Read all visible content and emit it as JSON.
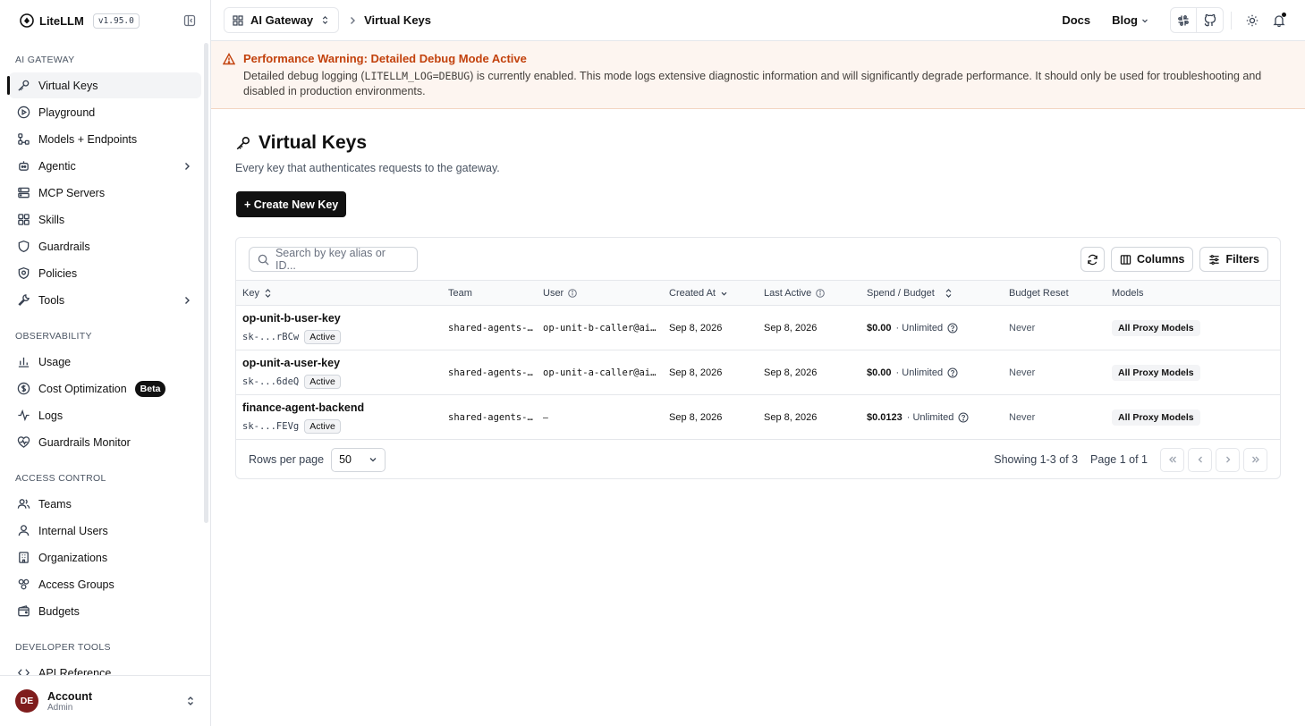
{
  "app": {
    "name": "LiteLLM",
    "version": "v1.95.0"
  },
  "sidebar": {
    "sections": [
      {
        "label": "AI GATEWAY",
        "items": [
          {
            "label": "Virtual Keys",
            "icon": "key-icon",
            "active": true
          },
          {
            "label": "Playground",
            "icon": "play-icon"
          },
          {
            "label": "Models + Endpoints",
            "icon": "models-icon"
          },
          {
            "label": "Agentic",
            "icon": "agentic-icon",
            "expandable": true
          },
          {
            "label": "MCP Servers",
            "icon": "server-icon"
          },
          {
            "label": "Skills",
            "icon": "skills-icon"
          },
          {
            "label": "Guardrails",
            "icon": "shield-icon"
          },
          {
            "label": "Policies",
            "icon": "policy-icon"
          },
          {
            "label": "Tools",
            "icon": "wrench-icon",
            "expandable": true
          }
        ]
      },
      {
        "label": "OBSERVABILITY",
        "items": [
          {
            "label": "Usage",
            "icon": "bar-chart-icon"
          },
          {
            "label": "Cost Optimization",
            "icon": "dollar-icon",
            "badge": "Beta"
          },
          {
            "label": "Logs",
            "icon": "activity-icon"
          },
          {
            "label": "Guardrails Monitor",
            "icon": "heart-monitor-icon"
          }
        ]
      },
      {
        "label": "ACCESS CONTROL",
        "items": [
          {
            "label": "Teams",
            "icon": "users-icon"
          },
          {
            "label": "Internal Users",
            "icon": "user-icon"
          },
          {
            "label": "Organizations",
            "icon": "building-icon"
          },
          {
            "label": "Access Groups",
            "icon": "groups-icon"
          },
          {
            "label": "Budgets",
            "icon": "wallet-icon"
          }
        ]
      },
      {
        "label": "DEVELOPER TOOLS",
        "items": [
          {
            "label": "API Reference",
            "icon": "code-icon"
          }
        ]
      }
    ],
    "account": {
      "initials": "DE",
      "name": "Account",
      "role": "Admin"
    }
  },
  "topbar": {
    "gateway_label": "AI Gateway",
    "breadcrumb_current": "Virtual Keys",
    "docs_label": "Docs",
    "blog_label": "Blog"
  },
  "warning": {
    "title": "Performance Warning: Detailed Debug Mode Active",
    "body_prefix": "Detailed debug logging (",
    "body_code": "LITELLM_LOG=DEBUG",
    "body_suffix": ") is currently enabled. This mode logs extensive diagnostic information and will significantly degrade performance. It should only be used for troubleshooting and disabled in production environments."
  },
  "page": {
    "title": "Virtual Keys",
    "subtitle": "Every key that authenticates requests to the gateway.",
    "create_label": "+ Create New Key"
  },
  "table": {
    "search_placeholder": "Search by key alias or ID...",
    "columns_label": "Columns",
    "filters_label": "Filters",
    "headers": {
      "key": "Key",
      "team": "Team",
      "user": "User",
      "created": "Created At",
      "last_active": "Last Active",
      "spend": "Spend / Budget",
      "reset": "Budget Reset",
      "models": "Models"
    },
    "rows": [
      {
        "alias": "op-unit-b-user-key",
        "key_id": "sk-...rBCw",
        "status": "Active",
        "team": "shared-agents-…",
        "user": "op-unit-b-caller@ai…",
        "created": "Sep 8, 2026",
        "last_active": "Sep 8, 2026",
        "spend": "$0.00",
        "budget": "· Unlimited",
        "reset": "Never",
        "models": "All Proxy Models"
      },
      {
        "alias": "op-unit-a-user-key",
        "key_id": "sk-...6deQ",
        "status": "Active",
        "team": "shared-agents-…",
        "user": "op-unit-a-caller@ai…",
        "created": "Sep 8, 2026",
        "last_active": "Sep 8, 2026",
        "spend": "$0.00",
        "budget": "· Unlimited",
        "reset": "Never",
        "models": "All Proxy Models"
      },
      {
        "alias": "finance-agent-backend",
        "key_id": "sk-...FEVg",
        "status": "Active",
        "team": "shared-agents-…",
        "user": "–",
        "created": "Sep 8, 2026",
        "last_active": "Sep 8, 2026",
        "spend": "$0.0123",
        "budget": "· Unlimited",
        "reset": "Never",
        "models": "All Proxy Models"
      }
    ],
    "rows_per_page_label": "Rows per page",
    "rows_per_page_value": "50",
    "showing": "Showing 1-3 of 3",
    "page_of": "Page 1 of 1"
  },
  "colors": {
    "accent": "#111111",
    "warning": "#c2410c",
    "warning_bg": "#fdf5f0",
    "avatar": "#7f1d1d"
  }
}
